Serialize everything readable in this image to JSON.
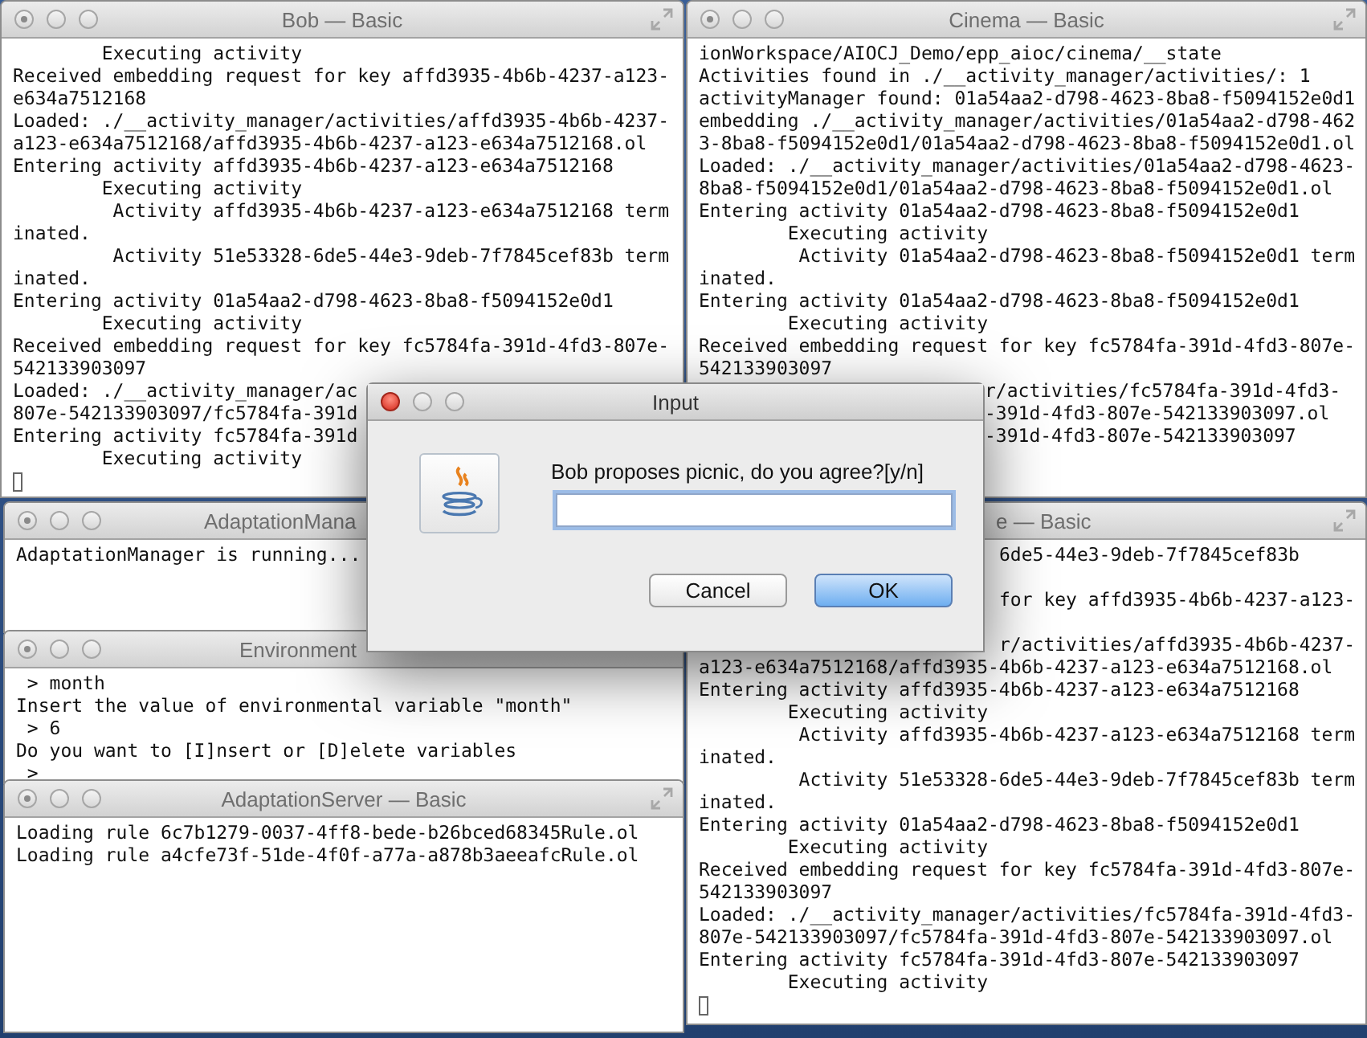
{
  "windows": [
    {
      "title": "Bob — Basic",
      "active": false,
      "fullscreen_button": true,
      "cursor": true,
      "lines": [
        {
          "kind": "full",
          "text": "        Executing activity"
        },
        {
          "kind": "full",
          "text": "Received embedding request for key affd3935-4b6b-4237-a123-"
        },
        {
          "kind": "full",
          "text": "e634a7512168"
        },
        {
          "kind": "full",
          "text": "Loaded: ./__activity_manager/activities/affd3935-4b6b-4237-"
        },
        {
          "kind": "full",
          "text": "a123-e634a7512168/affd3935-4b6b-4237-a123-e634a7512168.ol"
        },
        {
          "kind": "full",
          "text": "Entering activity affd3935-4b6b-4237-a123-e634a7512168"
        },
        {
          "kind": "full",
          "text": "        Executing activity"
        },
        {
          "kind": "full",
          "text": "         Activity affd3935-4b6b-4237-a123-e634a7512168 term"
        },
        {
          "kind": "full",
          "text": "inated."
        },
        {
          "kind": "full",
          "text": "         Activity 51e53328-6de5-44e3-9deb-7f7845cef83b term"
        },
        {
          "kind": "full",
          "text": "inated."
        },
        {
          "kind": "full",
          "text": "Entering activity 01a54aa2-d798-4623-8ba8-f5094152e0d1"
        },
        {
          "kind": "full",
          "text": "        Executing activity"
        },
        {
          "kind": "full",
          "text": "Received embedding request for key fc5784fa-391d-4fd3-807e-"
        },
        {
          "kind": "full",
          "text": "542133903097"
        },
        {
          "kind": "full",
          "text": "Loaded: ./__activity_manager/ac"
        },
        {
          "kind": "full",
          "text": "807e-542133903097/fc5784fa-391d"
        },
        {
          "kind": "full",
          "text": "Entering activity fc5784fa-391d"
        },
        {
          "kind": "full",
          "text": "        Executing activity"
        }
      ]
    },
    {
      "title": "Cinema — Basic",
      "active": false,
      "fullscreen_button": true,
      "cursor": false,
      "lines": [
        {
          "kind": "full",
          "text": "ionWorkspace/AIOCJ_Demo/epp_aioc/cinema/__state"
        },
        {
          "kind": "full",
          "text": "Activities found in ./__activity_manager/activities/: 1"
        },
        {
          "kind": "full",
          "text": "activityManager found: 01a54aa2-d798-4623-8ba8-f5094152e0d1"
        },
        {
          "kind": "full",
          "text": "embedding ./__activity_manager/activities/01a54aa2-d798-462"
        },
        {
          "kind": "full",
          "text": "3-8ba8-f5094152e0d1/01a54aa2-d798-4623-8ba8-f5094152e0d1.ol"
        },
        {
          "kind": "full",
          "text": "Loaded: ./__activity_manager/activities/01a54aa2-d798-4623-"
        },
        {
          "kind": "full",
          "text": "8ba8-f5094152e0d1/01a54aa2-d798-4623-8ba8-f5094152e0d1.ol"
        },
        {
          "kind": "full",
          "text": "Entering activity 01a54aa2-d798-4623-8ba8-f5094152e0d1"
        },
        {
          "kind": "full",
          "text": "        Executing activity"
        },
        {
          "kind": "full",
          "text": "         Activity 01a54aa2-d798-4623-8ba8-f5094152e0d1 term"
        },
        {
          "kind": "full",
          "text": "inated."
        },
        {
          "kind": "full",
          "text": "Entering activity 01a54aa2-d798-4623-8ba8-f5094152e0d1"
        },
        {
          "kind": "full",
          "text": "        Executing activity"
        },
        {
          "kind": "full",
          "text": "Received embedding request for key fc5784fa-391d-4fd3-807e-"
        },
        {
          "kind": "full",
          "text": "542133903097"
        },
        {
          "kind": "clipped",
          "text": "r/activities/fc5784fa-391d-4fd3-"
        },
        {
          "kind": "clipped",
          "text": "-391d-4fd3-807e-542133903097.ol"
        },
        {
          "kind": "clipped",
          "text": "-391d-4fd3-807e-542133903097"
        }
      ]
    },
    {
      "title": "AdaptationMana",
      "active": false,
      "cursor": false,
      "lines": [
        {
          "kind": "full",
          "text": "AdaptationManager is running..."
        }
      ]
    },
    {
      "title": "e — Basic",
      "active": false,
      "fullscreen_button": true,
      "cursor": true,
      "lines": [
        {
          "kind": "clipped",
          "text": "6de5-44e3-9deb-7f7845cef83b"
        },
        {
          "kind": "covered"
        },
        {
          "kind": "clipped",
          "text": "for key affd3935-4b6b-4237-a123-"
        },
        {
          "kind": "covered"
        },
        {
          "kind": "clipped",
          "text": "r/activities/affd3935-4b6b-4237-"
        },
        {
          "kind": "full",
          "text": "a123-e634a7512168/affd3935-4b6b-4237-a123-e634a7512168.ol"
        },
        {
          "kind": "full",
          "text": "Entering activity affd3935-4b6b-4237-a123-e634a7512168"
        },
        {
          "kind": "full",
          "text": "        Executing activity"
        },
        {
          "kind": "full",
          "text": "         Activity affd3935-4b6b-4237-a123-e634a7512168 term"
        },
        {
          "kind": "full",
          "text": "inated."
        },
        {
          "kind": "full",
          "text": "         Activity 51e53328-6de5-44e3-9deb-7f7845cef83b term"
        },
        {
          "kind": "full",
          "text": "inated."
        },
        {
          "kind": "full",
          "text": "Entering activity 01a54aa2-d798-4623-8ba8-f5094152e0d1"
        },
        {
          "kind": "full",
          "text": "        Executing activity"
        },
        {
          "kind": "full",
          "text": "Received embedding request for key fc5784fa-391d-4fd3-807e-"
        },
        {
          "kind": "full",
          "text": "542133903097"
        },
        {
          "kind": "full",
          "text": "Loaded: ./__activity_manager/activities/fc5784fa-391d-4fd3-"
        },
        {
          "kind": "full",
          "text": "807e-542133903097/fc5784fa-391d-4fd3-807e-542133903097.ol"
        },
        {
          "kind": "full",
          "text": "Entering activity fc5784fa-391d-4fd3-807e-542133903097"
        },
        {
          "kind": "full",
          "text": "        Executing activity"
        }
      ]
    },
    {
      "title": "Environment",
      "active": false,
      "lines": [
        {
          "kind": "full",
          "text": " > month"
        },
        {
          "kind": "full",
          "text": "Insert the value of environmental variable \"month\""
        },
        {
          "kind": "full",
          "text": " > 6"
        },
        {
          "kind": "full",
          "text": "Do you want to [I]nsert or [D]elete variables"
        },
        {
          "kind": "full",
          "text": " >"
        }
      ]
    },
    {
      "title": "AdaptationServer — Basic",
      "active": false,
      "fullscreen_button": true,
      "cursor": false,
      "lines": [
        {
          "kind": "full",
          "text": "Loading rule 6c7b1279-0037-4ff8-bede-b26bced68345Rule.ol"
        },
        {
          "kind": "full",
          "text": "Loading rule a4cfe73f-51de-4f0f-a77a-a878b3aeeafcRule.ol"
        }
      ]
    }
  ],
  "dialog": {
    "title": "Input",
    "active": true,
    "prompt": "Bob proposes picnic, do you agree?[y/n]",
    "buttons": [
      {
        "label": "Cancel",
        "default": false
      },
      {
        "label": "OK",
        "default": true
      }
    ]
  }
}
